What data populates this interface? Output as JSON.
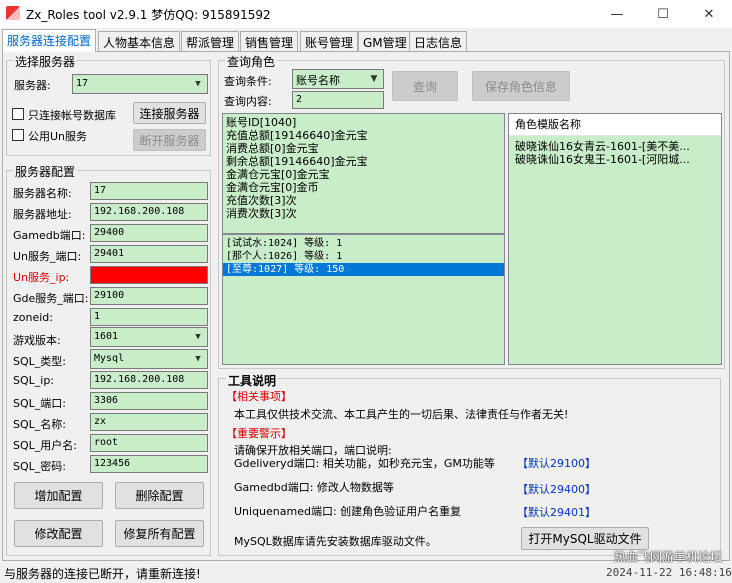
{
  "window": {
    "title": "Zx_Roles tool v2.9.1 梦仿QQ: 915891592"
  },
  "tabs": [
    "服务器连接配置",
    "人物基本信息",
    "帮派管理",
    "销售管理",
    "账号管理",
    "GM管理",
    "日志信息"
  ],
  "select_server": {
    "title": "选择服务器",
    "server_label": "服务器:",
    "server_value": "17",
    "only_account_db": "只连接帐号数据库",
    "public_un": "公用Un服务",
    "connect_btn": "连接服务器",
    "disconnect_btn": "断开服务器"
  },
  "server_config": {
    "title": "服务器配置",
    "fields": [
      {
        "label": "服务器名称:",
        "value": "17"
      },
      {
        "label": "服务器地址:",
        "value": "192.168.200.108"
      },
      {
        "label": "Gamedb端口:",
        "value": "29400"
      },
      {
        "label": "Un服务_端口:",
        "value": "29401"
      },
      {
        "label": "Un服务_ip:",
        "value": ""
      },
      {
        "label": "Gde服务_端口:",
        "value": "29100"
      },
      {
        "label": "zoneid:",
        "value": "1"
      },
      {
        "label": "游戏版本:",
        "value": "1601"
      },
      {
        "label": "SQL_类型:",
        "value": "Mysql"
      },
      {
        "label": "SQL_ip:",
        "value": "192.168.200.108"
      },
      {
        "label": "SQL_端口:",
        "value": "3306"
      },
      {
        "label": "SQL_名称:",
        "value": "zx"
      },
      {
        "label": "SQL_用户名:",
        "value": "root"
      },
      {
        "label": "SQL_密码:",
        "value": "123456"
      }
    ],
    "add_btn": "增加配置",
    "delete_btn": "删除配置",
    "modify_btn": "修改配置",
    "repair_btn": "修复所有配置"
  },
  "query_role": {
    "title": "查询角色",
    "condition_label": "查询条件:",
    "condition_value": "账号名称",
    "content_label": "查询内容:",
    "content_value": "2",
    "query_btn": "查询",
    "save_btn": "保存角色信息",
    "account_info": [
      "账号ID[1040]",
      "充值总额[19146640]金元宝",
      "消费总额[0]金元宝",
      "剩余总额[19146640]金元宝",
      "金满仓元宝[0]金元宝",
      "金满仓元宝[0]金币",
      "充值次数[3]次",
      "消费次数[3]次"
    ],
    "roles": [
      "[试试水:1024] 等级: 1",
      "[那个人:1026] 等级: 1",
      "[至尊:1027] 等级: 150"
    ],
    "template_header": "角色模版名称",
    "templates": [
      "破晓诛仙16女青云-1601-[美不美...",
      "破晓诛仙16女鬼王-1601-[河阳城..."
    ]
  },
  "tool_info": {
    "title": "工具说明",
    "notice_title": "【相关事项】",
    "notice_text": "本工具仅供技术交流、本工具产生的一切后果、法律责任与作者无关!",
    "warning_title": "【重要警示】",
    "warning_text": "请确保开放相关端口，端口说明:",
    "port_lines": [
      {
        "text": "Gdeliveryd端口: 相关功能，如秒充元宝，GM功能等",
        "default": "【默认29100】"
      },
      {
        "text": "Gamedbd端口: 修改人物数据等",
        "default": "【默认29400】"
      },
      {
        "text": "Uniquenamed端口: 创建角色验证用户名重复",
        "default": "【默认29401】"
      }
    ],
    "mysql_text": "MySQL数据库请先安装数据库驱动文件。",
    "mysql_btn": "打开MySQL驱动文件"
  },
  "status": {
    "message": "与服务器的连接已断开，请重新连接!",
    "time": "2024-11-22 16:48:16"
  },
  "watermark": "热血飞网游单机论坛"
}
